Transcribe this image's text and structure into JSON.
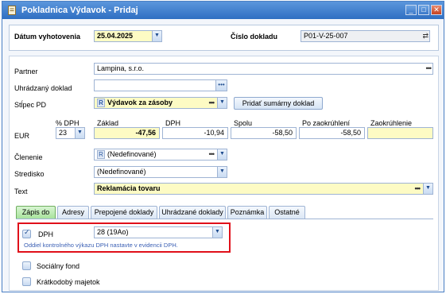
{
  "window": {
    "title": "Pokladnica Výdavok - Pridaj",
    "controls": [
      "_",
      "□",
      "✕"
    ]
  },
  "header": {
    "date_label": "Dátum vyhotovenia",
    "date_value": "25.04.2025",
    "docnum_label": "Číslo dokladu",
    "docnum_value": "P01-V-25-007"
  },
  "form": {
    "partner_label": "Partner",
    "partner_value": "Lampina, s.r.o.",
    "paid_doc_label": "Uhrádzaný doklad",
    "paid_doc_value": "",
    "column_label": "Stĺpec PD",
    "column_badge": "R",
    "column_value": "Výdavok za zásoby",
    "add_summary_button": "Pridať sumárny doklad",
    "currency_label": "EUR",
    "vat_pct_label": "% DPH",
    "vat_pct_value": "23",
    "base_label": "Základ",
    "base_value": "-47,56",
    "vat_label": "DPH",
    "vat_value": "-10,94",
    "total_label": "Spolu",
    "total_value": "-58,50",
    "rounded_label": "Po zaokrúhlení",
    "rounded_value": "-58,50",
    "rounding_label": "Zaokrúhlenie",
    "rounding_value": "",
    "split_label": "Členenie",
    "split_badge": "R",
    "split_value": "(Nedefinované)",
    "center_label": "Stredisko",
    "center_value": "(Nedefinované)",
    "text_label": "Text",
    "text_value": "Reklamácia tovaru"
  },
  "tabs": [
    {
      "label": "Zápis do",
      "active": true
    },
    {
      "label": "Adresy"
    },
    {
      "label": "Prepojené doklady"
    },
    {
      "label": "Uhrádzané doklady"
    },
    {
      "label": "Poznámka"
    },
    {
      "label": "Ostatné"
    }
  ],
  "tab_content": {
    "dph_label": "DPH",
    "dph_value": "28 (19Ao)",
    "dph_note": "Oddiel kontrolného výkazu DPH nastavte v evidencii DPH.",
    "social_fund_label": "Sociálny fond",
    "short_term_label": "Krátkodobý majetok"
  },
  "colors": {
    "highlight_box": "#e0101a",
    "required_field": "#fdfbc4",
    "active_tab": "#a8e39c",
    "title_bar": "#2f6fc2"
  },
  "icons": [
    "document-icon",
    "dropdown-arrow-icon",
    "browse-dots-icon",
    "copy-icon",
    "checkbox-icon"
  ]
}
